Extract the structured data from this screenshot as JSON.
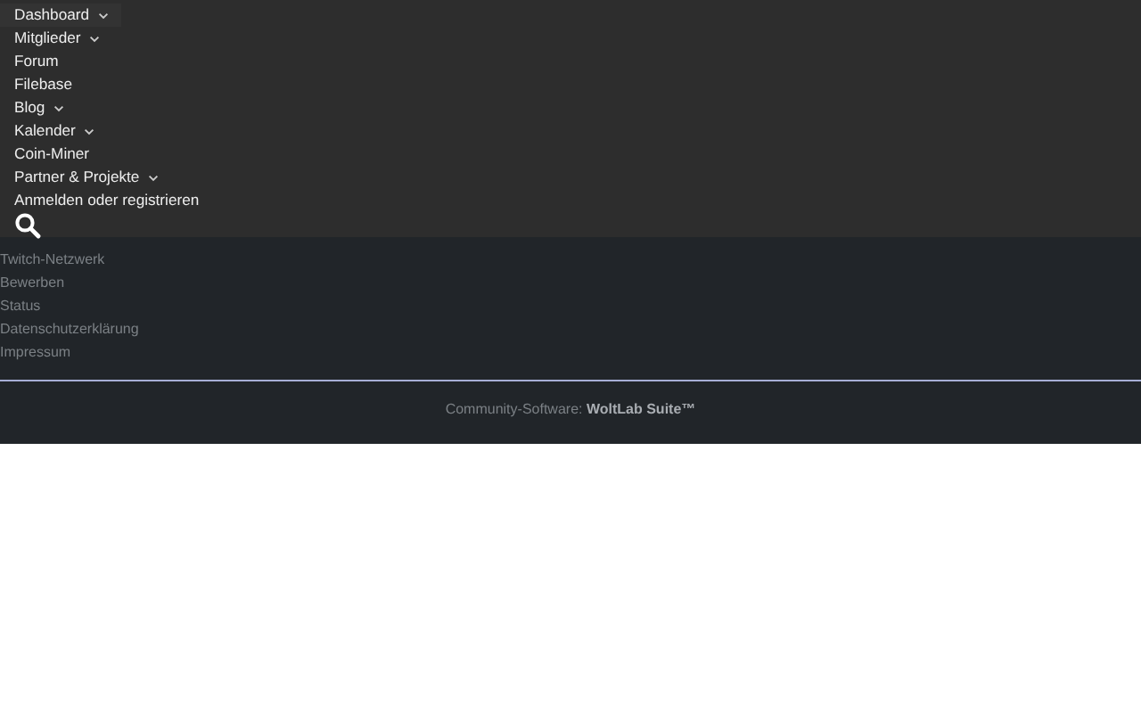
{
  "menu": [
    {
      "label": "Dashboard",
      "has_submenu": true,
      "selected": true
    },
    {
      "label": "Mitglieder",
      "has_submenu": true,
      "selected": false
    },
    {
      "label": "Forum",
      "has_submenu": false,
      "selected": false
    },
    {
      "label": "Filebase",
      "has_submenu": false,
      "selected": false
    },
    {
      "label": "Blog",
      "has_submenu": true,
      "selected": false
    },
    {
      "label": "Kalender",
      "has_submenu": true,
      "selected": false
    },
    {
      "label": "Coin-Miner",
      "has_submenu": false,
      "selected": false
    },
    {
      "label": "Partner & Projekte",
      "has_submenu": true,
      "selected": false
    },
    {
      "label": "Anmelden oder registrieren",
      "has_submenu": false,
      "selected": false
    }
  ],
  "footer_links": [
    "Twitch-Netzwerk",
    "Bewerben",
    "Status",
    "Datenschutzerklärung",
    "Impressum"
  ],
  "copyright": "Community-Software: **WoltLab Suite™**"
}
